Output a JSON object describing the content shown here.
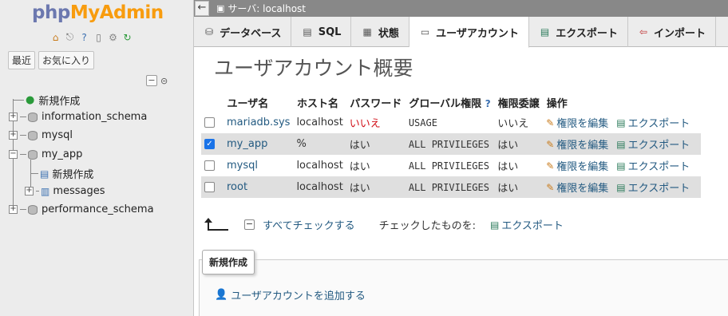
{
  "logo": {
    "php": "php",
    "my": "MyAdmin"
  },
  "sidebar": {
    "recent_label": "最近",
    "favorites_label": "お気に入り",
    "tree": {
      "new": "新規作成",
      "dbs": [
        "information_schema",
        "mysql",
        "my_app",
        "performance_schema"
      ],
      "my_app_children": {
        "new": "新規作成",
        "messages": "messages"
      }
    }
  },
  "topbar": {
    "server_label": "サーバ: localhost"
  },
  "tabs": [
    {
      "label": "データベース",
      "icon": "database-icon"
    },
    {
      "label": "SQL",
      "icon": "sql-icon"
    },
    {
      "label": "状態",
      "icon": "status-icon"
    },
    {
      "label": "ユーザアカウント",
      "icon": "users-icon"
    },
    {
      "label": "エクスポート",
      "icon": "export-icon"
    },
    {
      "label": "インポート",
      "icon": "import-icon"
    }
  ],
  "page_title": "ユーザアカウント概要",
  "table": {
    "headers": {
      "user": "ユーザ名",
      "host": "ホスト名",
      "password": "パスワード",
      "global": "グローバル権限",
      "grant": "権限委譲",
      "action": "操作"
    },
    "rows": [
      {
        "user": "mariadb.sys",
        "host": "localhost",
        "password": "いいえ",
        "global": "USAGE",
        "grant": "いいえ",
        "checked": false
      },
      {
        "user": "my_app",
        "host": "%",
        "password": "はい",
        "global": "ALL PRIVILEGES",
        "grant": "はい",
        "checked": true
      },
      {
        "user": "mysql",
        "host": "localhost",
        "password": "はい",
        "global": "ALL PRIVILEGES",
        "grant": "はい",
        "checked": false
      },
      {
        "user": "root",
        "host": "localhost",
        "password": "はい",
        "global": "ALL PRIVILEGES",
        "grant": "はい",
        "checked": false
      }
    ],
    "edit_label": "権限を編集",
    "export_label": "エクスポート"
  },
  "bulk": {
    "check_all": "すべてチェックする",
    "with_selected": "チェックしたものを:",
    "export": "エクスポート"
  },
  "new_section": {
    "legend": "新規作成",
    "add_user": "ユーザアカウントを追加する"
  }
}
